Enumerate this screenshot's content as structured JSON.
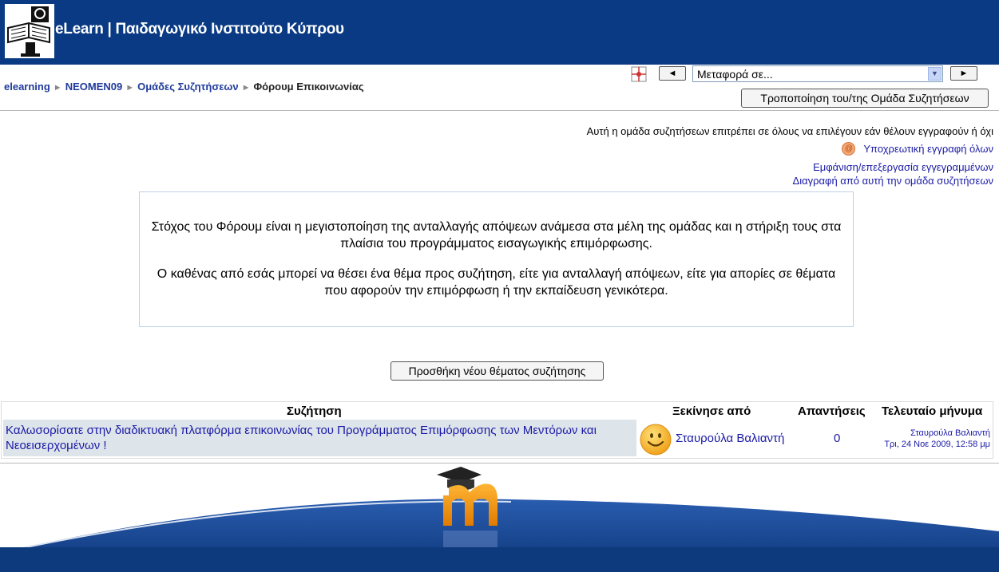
{
  "header": {
    "title": "eLearn | Παιδαγωγικό Ινστιτούτο Κύπρου",
    "logo_icon": "book-reader-icon",
    "bg_color": "#0a3a83"
  },
  "breadcrumb": {
    "items": [
      "elearning",
      "NEOMEN09",
      "Ομάδες Συζητήσεων"
    ],
    "current": "Φόρουμ Επικοινωνίας"
  },
  "nav": {
    "jump_placeholder": "Μεταφορά σε...",
    "prev_label": "◄",
    "next_label": "►",
    "edit_button": "Τροποποίηση του/της Ομάδα Συζητήσεων"
  },
  "subscription": {
    "info": "Αυτή η ομάδα συζητήσεων επιτρέπει σε όλους να επιλέγουν εάν θέλουν εγγραφούν ή όχι",
    "force": "Υποχρεωτική εγγραφή όλων",
    "show": "Εμφάνιση/επεξεργασία εγγεγραμμένων",
    "unsubscribe": "Διαγραφή από αυτή την ομάδα συζητήσεων"
  },
  "intro": {
    "p1": "Στόχος του Φόρουμ είναι η μεγιστοποίηση της ανταλλαγής απόψεων ανάμεσα στα μέλη της ομάδας και η στήριξη τους στα πλαίσια του προγράμματος εισαγωγικής επιμόρφωσης.",
    "p2": "Ο καθένας από εσάς μπορεί να θέσει ένα θέμα προς συζήτηση, είτε για ανταλλαγή απόψεων, είτε για απορίες σε θέματα που αφορούν την επιμόρφωση ή την εκπαίδευση γενικότερα."
  },
  "add_topic_button": "Προσθήκη νέου θέματος συζήτησης",
  "table": {
    "headers": {
      "topic": "Συζήτηση",
      "started_by": "Ξεκίνησε από",
      "replies": "Απαντήσεις",
      "last_post": "Τελευταίο μήνυμα"
    },
    "rows": [
      {
        "topic": "Καλωσορίσατε στην διαδικτυακή πλατφόρμα επικοινωνίας του Προγράμματος Επιμόρφωσης των Μεντόρων και Νεοεισερχομένων !",
        "author": "Σταυρούλα Βαλιαντή",
        "replies": "0",
        "last_user": "Σταυρούλα Βαλιαντή",
        "last_date": "Τρι, 24 Νοε 2009, 12:58 μμ"
      }
    ]
  },
  "footer": {
    "logo_icon": "moodle-logo-icon"
  }
}
